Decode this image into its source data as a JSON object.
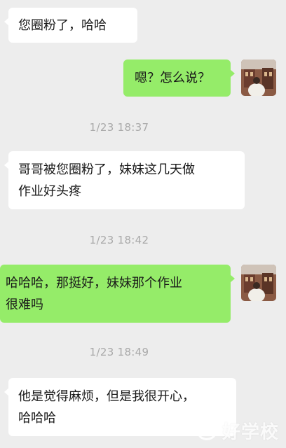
{
  "messages": [
    {
      "side": "in",
      "text": "您圈粉了，哈哈"
    },
    {
      "side": "out",
      "text": "嗯？怎么说？"
    },
    {
      "time": "1/23 18:37"
    },
    {
      "side": "in",
      "line1": "哥哥被您圈粉了，妹妹这几天做",
      "line2": "作业好头疼"
    },
    {
      "time": "1/23 18:42"
    },
    {
      "side": "out",
      "line1": "哈哈哈，那挺好，妹妹那个作业",
      "line2": "很难吗"
    },
    {
      "time": "1/23 18:49"
    },
    {
      "side": "in",
      "line1": "他是觉得麻烦，但是我很开心，",
      "line2": "哈哈哈"
    }
  ],
  "watermark": {
    "text": "好学校"
  },
  "colors": {
    "background": "#ededed",
    "incoming": "#ffffff",
    "outgoing": "#95ec69",
    "timestamp": "#a9a9a9"
  },
  "icons": [
    "avatar-photo"
  ]
}
